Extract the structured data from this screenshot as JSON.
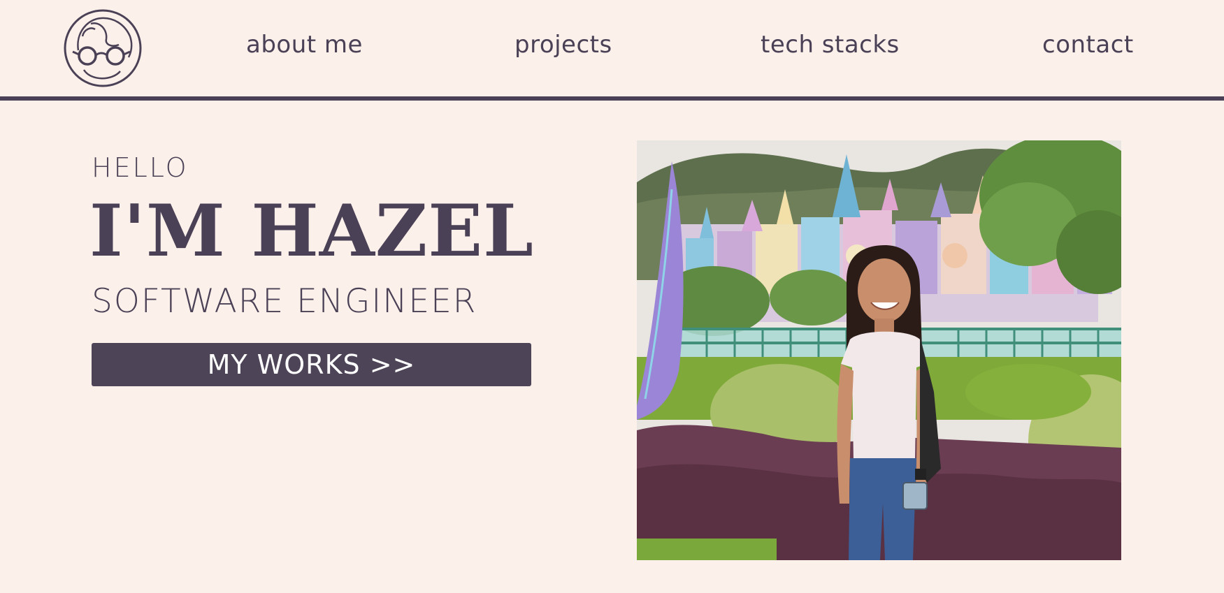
{
  "header": {
    "logo_icon": "glasses-woman-logo-icon",
    "nav": {
      "about": "about me",
      "projects": "projects",
      "tech": "tech stacks",
      "contact": "contact"
    }
  },
  "hero": {
    "greeting": "HELLO",
    "name": "I'M HAZEL",
    "role": "SOFTWARE ENGINEER",
    "cta_label": "MY WORKS >>"
  },
  "photo": {
    "alt": "Hazel standing in front of a colorful castle"
  },
  "colors": {
    "background": "#fbf0ea",
    "primary": "#4a4156",
    "button": "#4e4457",
    "button_text": "#ffffff"
  }
}
